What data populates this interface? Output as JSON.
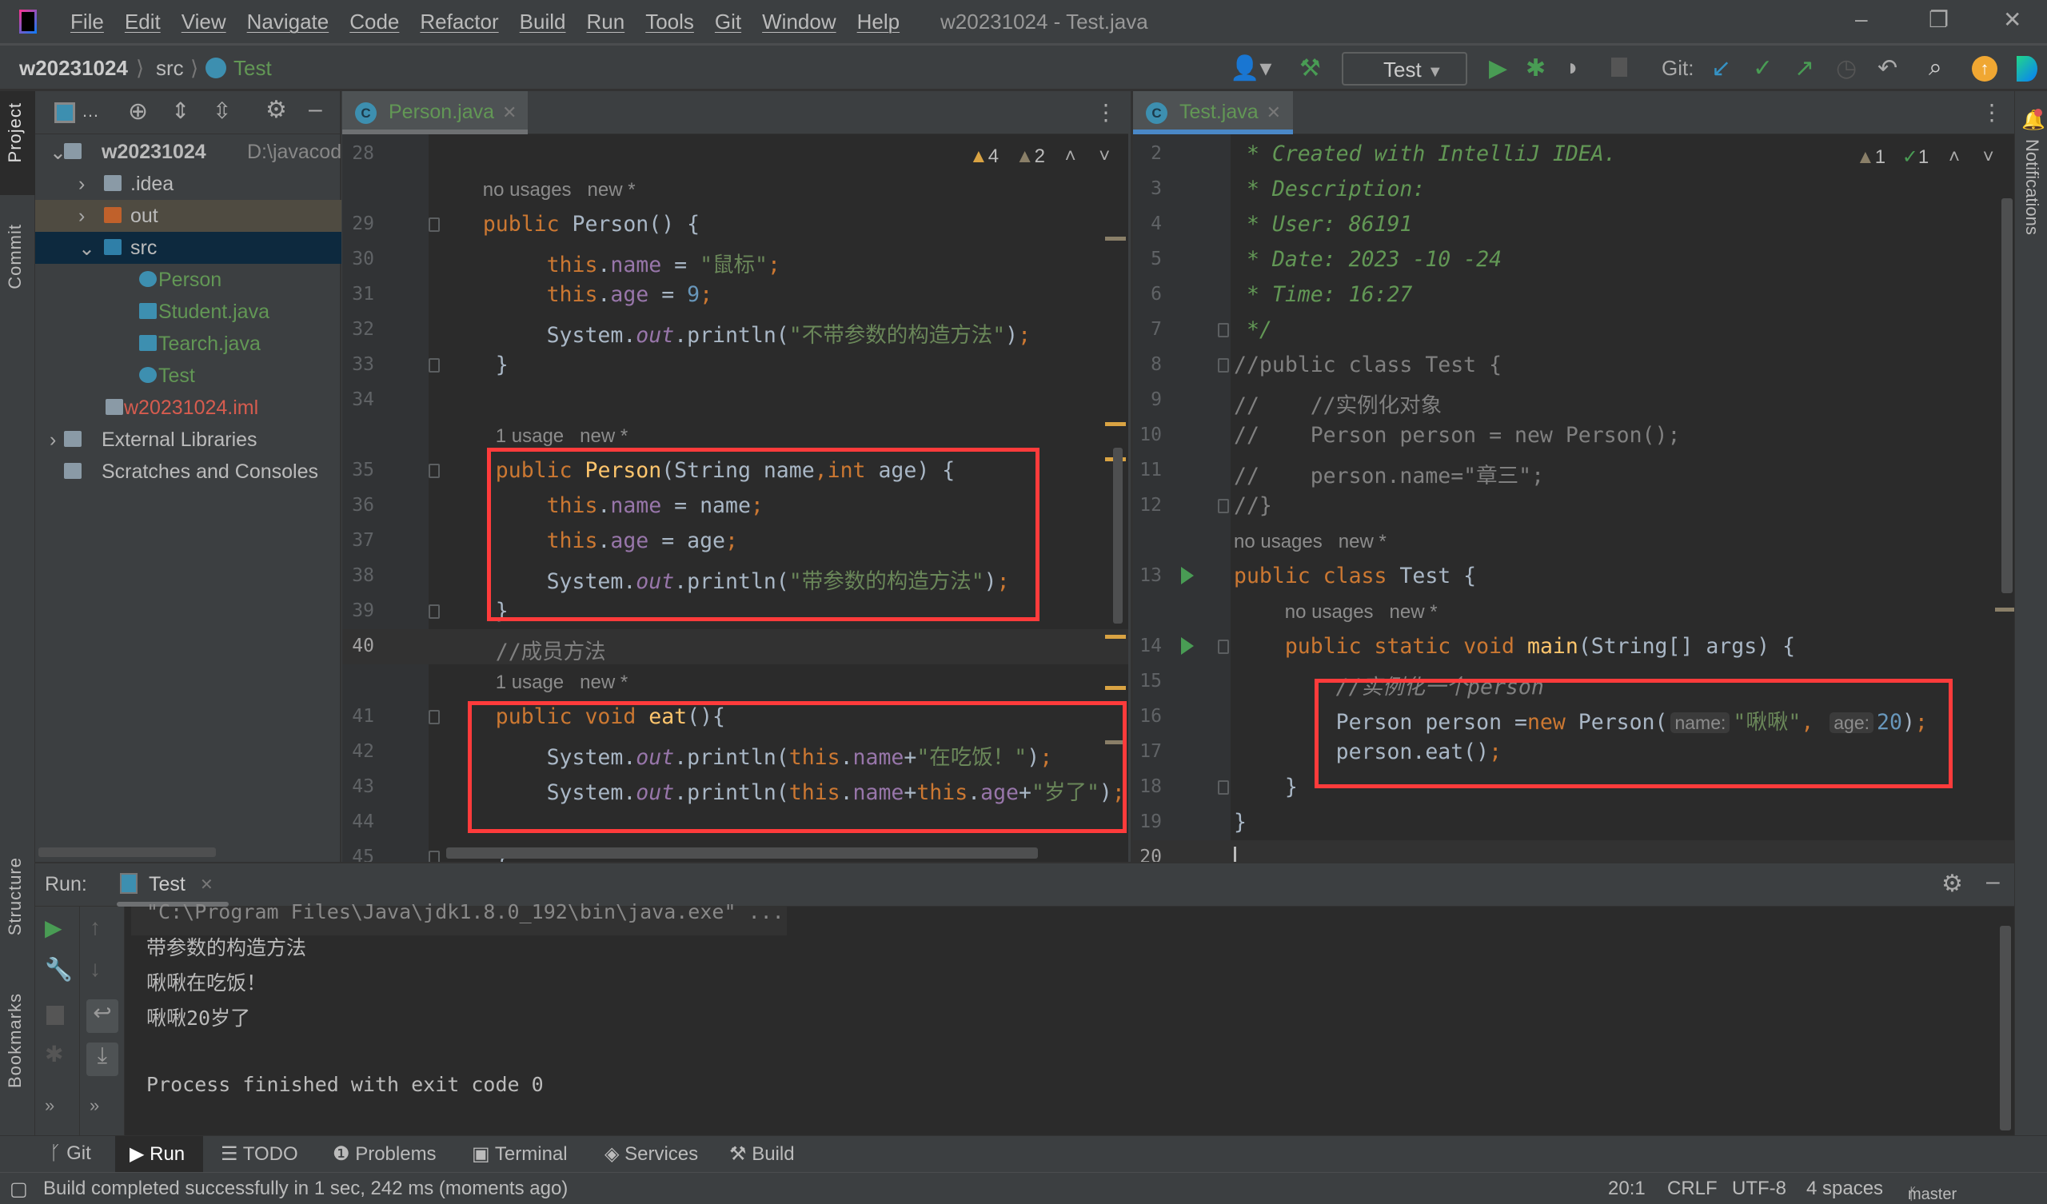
{
  "window": {
    "title": "w20231024 - Test.java",
    "menu": [
      "File",
      "Edit",
      "View",
      "Navigate",
      "Code",
      "Refactor",
      "Build",
      "Run",
      "Tools",
      "Git",
      "Window",
      "Help"
    ]
  },
  "breadcrumb": [
    "w20231024",
    "src",
    "Test"
  ],
  "toolbar": {
    "run_config": "Test",
    "git_label": "Git:"
  },
  "left_strip": [
    "Project",
    "Commit",
    "Structure",
    "Bookmarks"
  ],
  "right_strip": [
    "Notifications"
  ],
  "project": {
    "tree": [
      {
        "label": "w20231024",
        "extra": "D:\\javacode\\j",
        "type": "module",
        "level": 0,
        "expanded": true
      },
      {
        "label": ".idea",
        "type": "folder",
        "level": 1,
        "expanded": false
      },
      {
        "label": "out",
        "type": "folder-excluded",
        "level": 1,
        "expanded": false
      },
      {
        "label": "src",
        "type": "folder-source",
        "level": 1,
        "expanded": true,
        "selected": true
      },
      {
        "label": "Person",
        "type": "class",
        "level": 2
      },
      {
        "label": "Student.java",
        "type": "java-file",
        "level": 2
      },
      {
        "label": "Tearch.java",
        "type": "java-file",
        "level": 2
      },
      {
        "label": "Test",
        "type": "class-run",
        "level": 2
      },
      {
        "label": "w20231024.iml",
        "type": "iml",
        "level": 1
      },
      {
        "label": "External Libraries",
        "type": "libraries",
        "level": 0,
        "expanded": false
      },
      {
        "label": "Scratches and Consoles",
        "type": "scratches",
        "level": 0
      }
    ]
  },
  "editor_left": {
    "tab": "Person.java",
    "inspections": {
      "warnings": "4",
      "weak_warnings": "2"
    },
    "current_line": "40",
    "rows": [
      {
        "n": "28",
        "t": []
      },
      {
        "ann": "    no usages   new *"
      },
      {
        "n": "29",
        "fold": true,
        "t": [
          [
            "    ",
            ""
          ],
          [
            "public",
            "k"
          ],
          [
            " Person() {",
            ""
          ]
        ]
      },
      {
        "n": "30",
        "t": [
          [
            "         ",
            ""
          ],
          [
            "this",
            "k"
          ],
          [
            ".",
            ""
          ],
          [
            "name",
            "f"
          ],
          [
            " = ",
            ""
          ],
          [
            "\"鼠标\"",
            "s"
          ],
          [
            ";",
            "k"
          ]
        ]
      },
      {
        "n": "31",
        "t": [
          [
            "         ",
            ""
          ],
          [
            "this",
            "k"
          ],
          [
            ".",
            ""
          ],
          [
            "age",
            "f"
          ],
          [
            " = ",
            ""
          ],
          [
            "9",
            "n"
          ],
          [
            ";",
            "k"
          ]
        ]
      },
      {
        "n": "32",
        "t": [
          [
            "         System.",
            ""
          ],
          [
            "out",
            "fi"
          ],
          [
            ".println(",
            ""
          ],
          [
            "\"不带参数的构造方法\"",
            "s"
          ],
          [
            ")",
            ""
          ],
          [
            ";",
            "k"
          ]
        ]
      },
      {
        "n": "33",
        "fold": true,
        "t": [
          [
            "     }",
            ""
          ]
        ]
      },
      {
        "n": "34",
        "t": []
      },
      {
        "ann": "     1 usage   new *"
      },
      {
        "n": "35",
        "fold": true,
        "t": [
          [
            "     ",
            ""
          ],
          [
            "public",
            "k"
          ],
          [
            " ",
            ""
          ],
          [
            "Person",
            "m"
          ],
          [
            "(String name",
            ""
          ],
          [
            ",",
            "k"
          ],
          [
            "int",
            "k"
          ],
          [
            " age) {",
            ""
          ]
        ]
      },
      {
        "n": "36",
        "t": [
          [
            "         ",
            ""
          ],
          [
            "this",
            "k"
          ],
          [
            ".",
            ""
          ],
          [
            "name",
            "f"
          ],
          [
            " = name",
            ""
          ],
          [
            ";",
            "k"
          ]
        ]
      },
      {
        "n": "37",
        "t": [
          [
            "         ",
            ""
          ],
          [
            "this",
            "k"
          ],
          [
            ".",
            ""
          ],
          [
            "age",
            "f"
          ],
          [
            " = age",
            ""
          ],
          [
            ";",
            "k"
          ]
        ]
      },
      {
        "n": "38",
        "t": [
          [
            "         System.",
            ""
          ],
          [
            "out",
            "fi"
          ],
          [
            ".println(",
            ""
          ],
          [
            "\"带参数的构造方法\"",
            "s"
          ],
          [
            ")",
            ""
          ],
          [
            ";",
            "k"
          ]
        ]
      },
      {
        "n": "39",
        "fold": true,
        "t": [
          [
            "     }",
            ""
          ]
        ]
      },
      {
        "n": "40",
        "cur": true,
        "t": [
          [
            "     //成员方法",
            "c"
          ]
        ]
      },
      {
        "ann": "     1 usage   new *"
      },
      {
        "n": "41",
        "fold": true,
        "t": [
          [
            "     ",
            ""
          ],
          [
            "public void",
            "k"
          ],
          [
            " ",
            ""
          ],
          [
            "eat",
            "m"
          ],
          [
            "(){",
            ""
          ]
        ]
      },
      {
        "n": "42",
        "t": [
          [
            "         System.",
            ""
          ],
          [
            "out",
            "fi"
          ],
          [
            ".println(",
            ""
          ],
          [
            "this",
            "k"
          ],
          [
            ".",
            ""
          ],
          [
            "name",
            "f"
          ],
          [
            "+",
            ""
          ],
          [
            "\"在吃饭！\"",
            "s"
          ],
          [
            ")",
            ""
          ],
          [
            ";",
            "k"
          ]
        ]
      },
      {
        "n": "43",
        "t": [
          [
            "         System.",
            ""
          ],
          [
            "out",
            "fi"
          ],
          [
            ".println(",
            ""
          ],
          [
            "this",
            "k"
          ],
          [
            ".",
            ""
          ],
          [
            "name",
            "f"
          ],
          [
            "+",
            ""
          ],
          [
            "this",
            "k"
          ],
          [
            ".",
            ""
          ],
          [
            "age",
            "f"
          ],
          [
            "+",
            ""
          ],
          [
            "\"岁了\"",
            "s"
          ],
          [
            ")",
            ""
          ],
          [
            ";",
            "k"
          ]
        ]
      },
      {
        "n": "44",
        "t": []
      },
      {
        "n": "45",
        "fold": true,
        "t": [
          [
            "     }",
            ""
          ]
        ]
      }
    ]
  },
  "editor_right": {
    "tab": "Test.java",
    "inspections": {
      "warnings": "1",
      "typos": "1"
    },
    "rows": [
      {
        "n": "2",
        "t": [
          [
            " * Created with IntelliJ IDEA.",
            "d"
          ]
        ]
      },
      {
        "n": "3",
        "t": [
          [
            " * Description:",
            "d"
          ]
        ]
      },
      {
        "n": "4",
        "t": [
          [
            " * User: 86191",
            "d"
          ]
        ]
      },
      {
        "n": "5",
        "t": [
          [
            " * Date: 2023 -10 -24",
            "d"
          ]
        ]
      },
      {
        "n": "6",
        "t": [
          [
            " * Time: 16:27",
            "d"
          ]
        ]
      },
      {
        "n": "7",
        "fold": true,
        "t": [
          [
            " */",
            "d"
          ]
        ]
      },
      {
        "n": "8",
        "fold": true,
        "t": [
          [
            "//public class Test {",
            "c"
          ]
        ]
      },
      {
        "n": "9",
        "t": [
          [
            "//    //实例化对象",
            "c"
          ]
        ]
      },
      {
        "n": "10",
        "t": [
          [
            "//    Person person = new Person();",
            "c"
          ]
        ]
      },
      {
        "n": "11",
        "t": [
          [
            "//    person.name=\"章三\";",
            "c"
          ]
        ]
      },
      {
        "n": "12",
        "fold": true,
        "t": [
          [
            "//}",
            "c"
          ]
        ]
      },
      {
        "ann": "no usages   new *"
      },
      {
        "n": "13",
        "run": true,
        "t": [
          [
            "public class",
            "k"
          ],
          [
            " Test {",
            ""
          ]
        ]
      },
      {
        "ann": "    no usages   new *"
      },
      {
        "n": "14",
        "run": true,
        "fold": true,
        "t": [
          [
            "    ",
            ""
          ],
          [
            "public static void",
            "k"
          ],
          [
            " ",
            ""
          ],
          [
            "main",
            "m"
          ],
          [
            "(String[] args) {",
            ""
          ]
        ]
      },
      {
        "n": "15",
        "t": [
          [
            "        //实例化一个person",
            "ci"
          ]
        ]
      },
      {
        "n": "16",
        "t": [
          [
            "        Person person =",
            ""
          ],
          [
            "new",
            "k"
          ],
          [
            " Person(",
            ""
          ],
          [
            "name:",
            "h"
          ],
          [
            "\"啾啾\"",
            "s"
          ],
          [
            ", ",
            "k"
          ],
          [
            "age:",
            "h"
          ],
          [
            "20",
            "n"
          ],
          [
            ")",
            ""
          ],
          [
            ";",
            "k"
          ]
        ]
      },
      {
        "n": "17",
        "t": [
          [
            "        person.eat()",
            ""
          ],
          [
            ";",
            "k"
          ]
        ]
      },
      {
        "n": "18",
        "fold": true,
        "t": [
          [
            "    }",
            ""
          ]
        ]
      },
      {
        "n": "19",
        "t": [
          [
            "}",
            ""
          ]
        ]
      },
      {
        "n": "20",
        "cur": true,
        "t": []
      }
    ]
  },
  "run": {
    "label": "Run:",
    "tab": "Test",
    "console": [
      "\"C:\\Program Files\\Java\\jdk1.8.0_192\\bin\\java.exe\" ...",
      "带参数的构造方法",
      "啾啾在吃饭！",
      "啾啾20岁了",
      "",
      "Process finished with exit code 0"
    ]
  },
  "bottom_tabs": [
    "Git",
    "Run",
    "TODO",
    "Problems",
    "Terminal",
    "Services",
    "Build"
  ],
  "status": {
    "message": "Build completed successfully in 1 sec, 242 ms (moments ago)",
    "position": "20:1",
    "line_sep": "CRLF",
    "encoding": "UTF-8",
    "indent": "4 spaces",
    "branch": "master"
  },
  "colors": {
    "keyword": "#cc7832",
    "string": "#6a8759",
    "number": "#6897bb",
    "field": "#9876aa",
    "method": "#ffc66d",
    "comment": "#808080",
    "doc": "#629755",
    "highlight_box": "#ff3b3b",
    "active_tab": "#4a88c7"
  }
}
